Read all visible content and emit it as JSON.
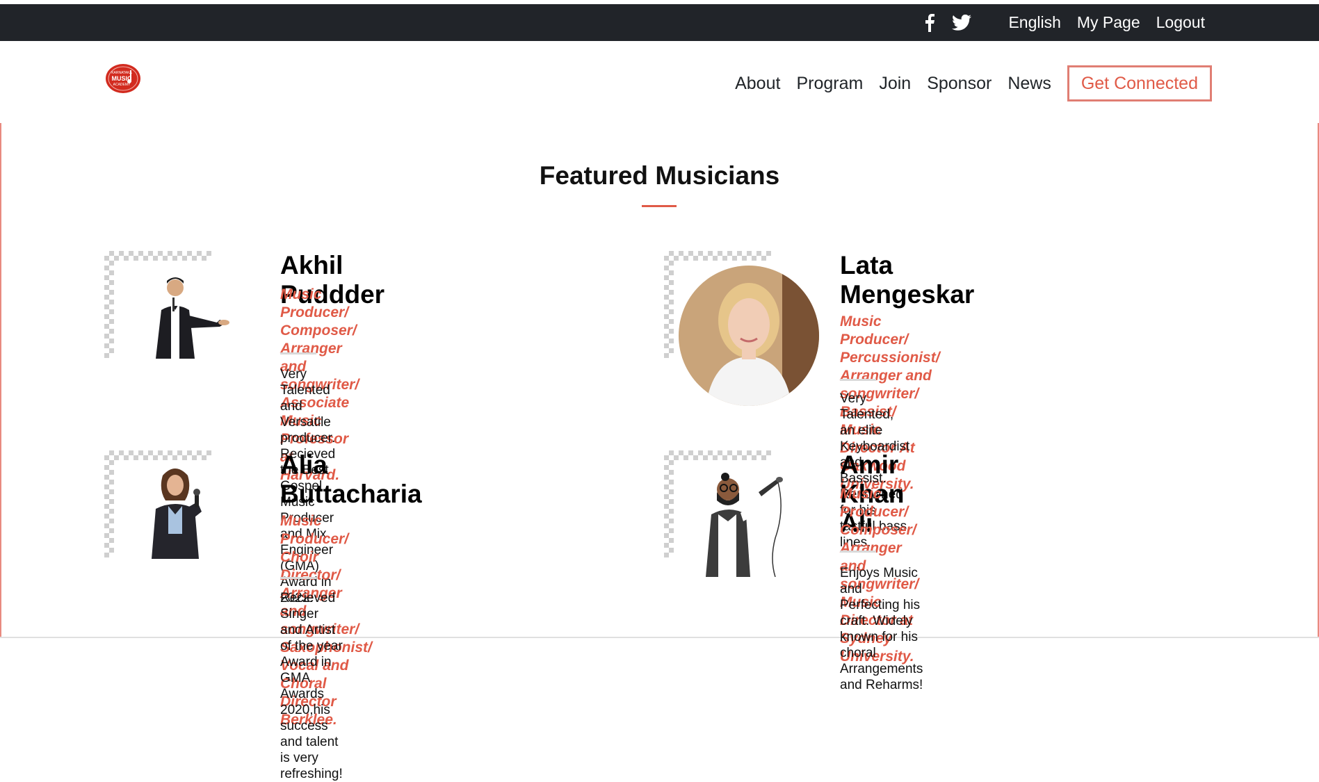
{
  "topbar": {
    "social": [
      {
        "icon": "facebook-icon"
      },
      {
        "icon": "twitter-icon"
      }
    ],
    "links": [
      "English",
      "My Page",
      "Logout"
    ]
  },
  "navbar": {
    "logo": {
      "text_lines": [
        "KARNATAKA",
        "MUSIC",
        "ACADEMY"
      ]
    },
    "links": [
      "About",
      "Program",
      "Join",
      "Sponsor",
      "News"
    ],
    "cta": "Get Connected"
  },
  "section": {
    "title": "Featured Musicians"
  },
  "musicians": [
    {
      "name_lines": [
        "Akhil Puddder"
      ],
      "role_lines": [
        "Music Producer/ Composer/ Arranger and",
        "songwriter/ Associate Music Professor at",
        "Harvard."
      ],
      "desc_lines": [
        "Very Talented and Versatile producer. Recieved the Best",
        "Gospel Music Producer and Mix Engineer (GMA) Award in",
        "2022."
      ],
      "photo": "man-in-suit-photo"
    },
    {
      "name_lines": [
        "Lata",
        "Mengeskar"
      ],
      "role_lines": [
        "Music Producer/ Percussionist/ Arranger and",
        "songwriter/ Bassist/ Music Director At",
        "Oakwood University."
      ],
      "desc_lines": [
        "Very Talented, an elite Keyboardist and Bassist. Renowned",
        "for his tastful bass lines."
      ],
      "photo": "blonde-woman-photo"
    },
    {
      "name_lines": [
        "Alia",
        "Buttacharia"
      ],
      "role_lines": [
        "Music Producer/ Choir Director/ Arranger and",
        "songwriter/ Saxophonist/ Vocal and Choral",
        "Director Berklee."
      ],
      "desc_lines": [
        "Recieved Singer and Artist of the year Award in GMA Awards",
        "2020,his success and talent is very refreshing!"
      ],
      "photo": "woman-with-microphone-photo"
    },
    {
      "name_lines": [
        "Amir Khan Ali"
      ],
      "role_lines": [
        "Music Producer/ Composer/ Arranger and",
        "songwriter/ Music Director at Sydney",
        "University."
      ],
      "desc_lines": [
        "Enjoys Music and Perfecting his craft. Widely known for his",
        "choral Arrangements and Reharms!"
      ],
      "photo": "bearded-singer-photo"
    }
  ],
  "colors": {
    "accent": "#e05a47",
    "topbar_bg": "#212429",
    "cta_border": "#e07e73"
  }
}
